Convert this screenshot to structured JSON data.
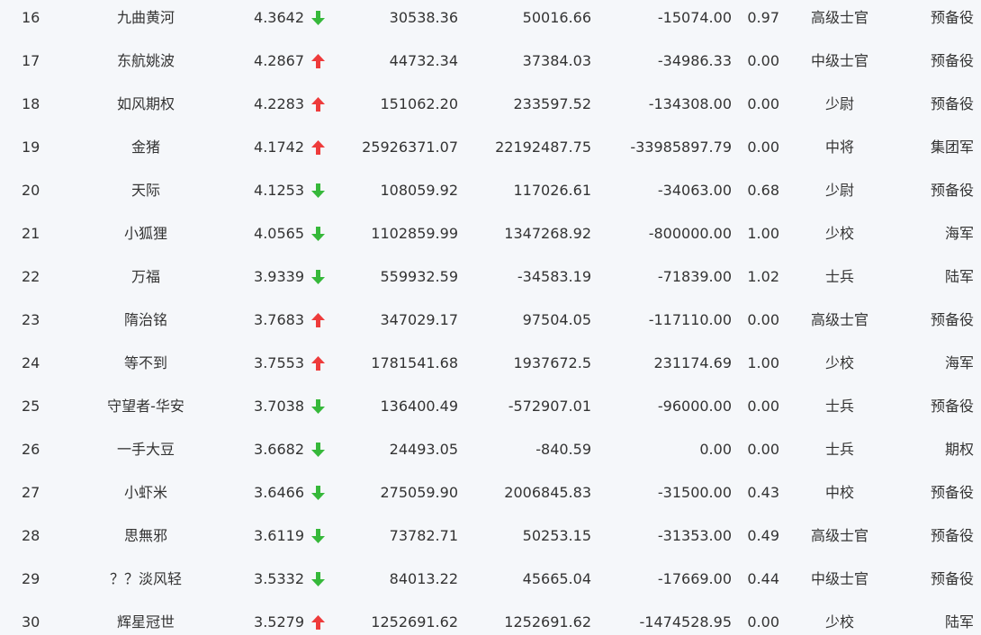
{
  "colors": {
    "up": "#ee3b3b",
    "down": "#36b83a"
  },
  "rows": [
    {
      "rank": "16",
      "name": "九曲黄河",
      "score": "4.3642",
      "trend": "down",
      "v1": "30538.36",
      "v2": "50016.66",
      "v3": "-15074.00",
      "v4": "0.97",
      "level": "高级士官",
      "category": "预备役"
    },
    {
      "rank": "17",
      "name": "东航姚波",
      "score": "4.2867",
      "trend": "up",
      "v1": "44732.34",
      "v2": "37384.03",
      "v3": "-34986.33",
      "v4": "0.00",
      "level": "中级士官",
      "category": "预备役"
    },
    {
      "rank": "18",
      "name": "如风期权",
      "score": "4.2283",
      "trend": "up",
      "v1": "151062.20",
      "v2": "233597.52",
      "v3": "-134308.00",
      "v4": "0.00",
      "level": "少尉",
      "category": "预备役"
    },
    {
      "rank": "19",
      "name": "金猪",
      "score": "4.1742",
      "trend": "up",
      "v1": "25926371.07",
      "v2": "22192487.75",
      "v3": "-33985897.79",
      "v4": "0.00",
      "level": "中将",
      "category": "集团军"
    },
    {
      "rank": "20",
      "name": "天际",
      "score": "4.1253",
      "trend": "down",
      "v1": "108059.92",
      "v2": "117026.61",
      "v3": "-34063.00",
      "v4": "0.68",
      "level": "少尉",
      "category": "预备役"
    },
    {
      "rank": "21",
      "name": "小狐狸",
      "score": "4.0565",
      "trend": "down",
      "v1": "1102859.99",
      "v2": "1347268.92",
      "v3": "-800000.00",
      "v4": "1.00",
      "level": "少校",
      "category": "海军"
    },
    {
      "rank": "22",
      "name": "万福",
      "score": "3.9339",
      "trend": "down",
      "v1": "559932.59",
      "v2": "-34583.19",
      "v3": "-71839.00",
      "v4": "1.02",
      "level": "士兵",
      "category": "陆军"
    },
    {
      "rank": "23",
      "name": "隋治铭",
      "score": "3.7683",
      "trend": "up",
      "v1": "347029.17",
      "v2": "97504.05",
      "v3": "-117110.00",
      "v4": "0.00",
      "level": "高级士官",
      "category": "预备役"
    },
    {
      "rank": "24",
      "name": "等不到",
      "score": "3.7553",
      "trend": "up",
      "v1": "1781541.68",
      "v2": "1937672.5",
      "v3": "231174.69",
      "v4": "1.00",
      "level": "少校",
      "category": "海军"
    },
    {
      "rank": "25",
      "name": "守望者-华安",
      "score": "3.7038",
      "trend": "down",
      "v1": "136400.49",
      "v2": "-572907.01",
      "v3": "-96000.00",
      "v4": "0.00",
      "level": "士兵",
      "category": "预备役"
    },
    {
      "rank": "26",
      "name": "一手大豆",
      "score": "3.6682",
      "trend": "down",
      "v1": "24493.05",
      "v2": "-840.59",
      "v3": "0.00",
      "v4": "0.00",
      "level": "士兵",
      "category": "期权"
    },
    {
      "rank": "27",
      "name": "小虾米",
      "score": "3.6466",
      "trend": "down",
      "v1": "275059.90",
      "v2": "2006845.83",
      "v3": "-31500.00",
      "v4": "0.43",
      "level": "中校",
      "category": "预备役"
    },
    {
      "rank": "28",
      "name": "思無邪",
      "score": "3.6119",
      "trend": "down",
      "v1": "73782.71",
      "v2": "50253.15",
      "v3": "-31353.00",
      "v4": "0.49",
      "level": "高级士官",
      "category": "预备役"
    },
    {
      "rank": "29",
      "name": "？？淡风轻",
      "score": "3.5332",
      "trend": "down",
      "v1": "84013.22",
      "v2": "45665.04",
      "v3": "-17669.00",
      "v4": "0.44",
      "level": "中级士官",
      "category": "预备役"
    },
    {
      "rank": "30",
      "name": "辉星冠世",
      "score": "3.5279",
      "trend": "up",
      "v1": "1252691.62",
      "v2": "1252691.62",
      "v3": "-1474528.95",
      "v4": "0.00",
      "level": "少校",
      "category": "陆军"
    }
  ]
}
